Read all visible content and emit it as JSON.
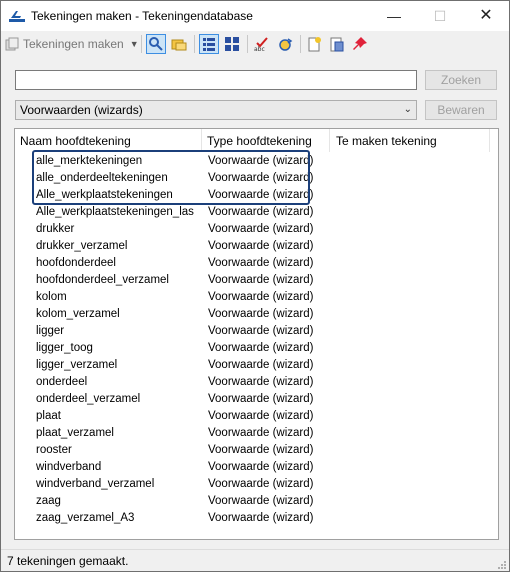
{
  "window": {
    "title": "Tekeningen maken - Tekeningendatabase"
  },
  "toolbar": {
    "drawings_button_label": "Tekeningen maken"
  },
  "search": {
    "value": "",
    "button_label": "Zoeken"
  },
  "filter": {
    "selected": "Voorwaarden (wizards)",
    "save_label": "Bewaren"
  },
  "list": {
    "columns": [
      "Naam hoofdtekening",
      "Type hoofdtekening",
      "Te maken tekening"
    ],
    "rows": [
      {
        "name": "alle_merktekeningen",
        "type": "Voorwaarde (wizard)"
      },
      {
        "name": "alle_onderdeeltekeningen",
        "type": "Voorwaarde (wizard)"
      },
      {
        "name": "Alle_werkplaatstekeningen",
        "type": "Voorwaarde (wizard)"
      },
      {
        "name": "Alle_werkplaatstekeningen_las",
        "type": "Voorwaarde (wizard)"
      },
      {
        "name": "drukker",
        "type": "Voorwaarde (wizard)"
      },
      {
        "name": "drukker_verzamel",
        "type": "Voorwaarde (wizard)"
      },
      {
        "name": "hoofdonderdeel",
        "type": "Voorwaarde (wizard)"
      },
      {
        "name": "hoofdonderdeel_verzamel",
        "type": "Voorwaarde (wizard)"
      },
      {
        "name": "kolom",
        "type": "Voorwaarde (wizard)"
      },
      {
        "name": "kolom_verzamel",
        "type": "Voorwaarde (wizard)"
      },
      {
        "name": "ligger",
        "type": "Voorwaarde (wizard)"
      },
      {
        "name": "ligger_toog",
        "type": "Voorwaarde (wizard)"
      },
      {
        "name": "ligger_verzamel",
        "type": "Voorwaarde (wizard)"
      },
      {
        "name": "onderdeel",
        "type": "Voorwaarde (wizard)"
      },
      {
        "name": "onderdeel_verzamel",
        "type": "Voorwaarde (wizard)"
      },
      {
        "name": "plaat",
        "type": "Voorwaarde (wizard)"
      },
      {
        "name": "plaat_verzamel",
        "type": "Voorwaarde (wizard)"
      },
      {
        "name": "rooster",
        "type": "Voorwaarde (wizard)"
      },
      {
        "name": "windverband",
        "type": "Voorwaarde (wizard)"
      },
      {
        "name": "windverband_verzamel",
        "type": "Voorwaarde (wizard)"
      },
      {
        "name": "zaag",
        "type": "Voorwaarde (wizard)"
      },
      {
        "name": "zaag_verzamel_A3",
        "type": "Voorwaarde (wizard)"
      }
    ]
  },
  "status": {
    "text": "7 tekeningen gemaakt."
  },
  "colors": {
    "highlight_border": "#1b3f7a",
    "accent": "#3d8ee2"
  }
}
